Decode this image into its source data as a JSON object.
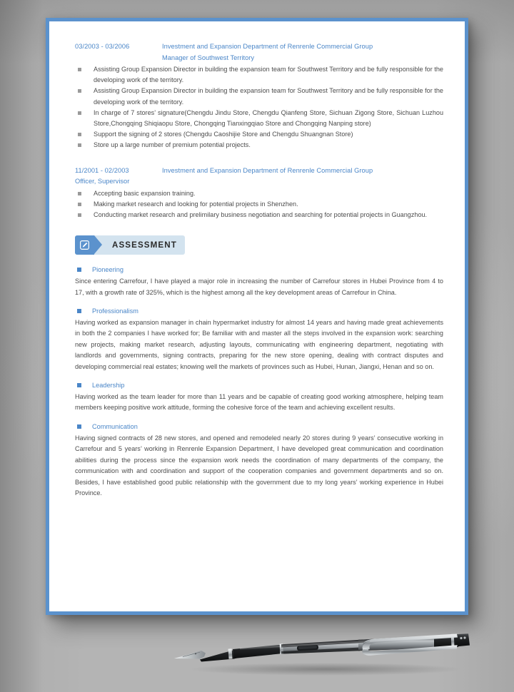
{
  "document": {
    "type": "resume-page",
    "page_border_color": "#5b92cd",
    "accent_color": "#4a86c8",
    "body_text_color": "#4c4c4c",
    "background_color": "#c2c2c2"
  },
  "experience": [
    {
      "dates": "03/2003 - 03/2006",
      "organization": "Investment and Expansion Department of Renrenle Commercial Group",
      "title": "Manager of Southwest Territory",
      "title_indented": true,
      "bullets": [
        "Assisting Group Expansion Director in building the expansion team for Southwest Territory and be fully responsible for the developing work of the territory.",
        "Assisting Group Expansion Director in building the expansion team for Southwest Territory and be fully responsible for the developing work of the territory.",
        "In charge of 7 stores’ signature(Chengdu Jindu Store, Chengdu Qianfeng Store, Sichuan Zigong Store, Sichuan Luzhou Store,Chongqing Shiqiaopu Store, Chongqing Tianxingqiao Store and Chongqing Nanping store)",
        "Support the signing of 2 stores (Chengdu Caoshijie Store and Chengdu Shuangnan Store)",
        "Store up a large number of premium potential projects."
      ]
    },
    {
      "dates": "11/2001 - 02/2003",
      "organization": "Investment and Expansion Department of Renrenle Commercial Group",
      "title": "Officer, Supervisor",
      "title_indented": false,
      "bullets": [
        "Accepting basic expansion training.",
        "Making market research and looking for potential projects in Shenzhen.",
        "Conducting market research and prelimilary business negotiation and searching for potential projects in Guangzhou."
      ]
    }
  ],
  "assessment_section": {
    "heading": "ASSESSMENT",
    "icon": "pencil-edit-icon",
    "items": [
      {
        "title": "Pioneering",
        "body": "Since entering Carrefour, I have played a major role in increasing the number of Carrefour stores in Hubei Province from 4 to 17, with a growth rate of 325%, which is the highest among all the key development areas of Carrefour in China."
      },
      {
        "title": "Professionalism",
        "body": "Having worked as expansion manager in chain hypermarket industry for almost 14 years and having made great achievements in both the 2 companies I have worked for; Be familiar with and master all the steps involved in the expansion work: searching new projects, making market research, adjusting layouts, communicating with engineering department, negotiating with landlords and governments, signing contracts, preparing for the new store opening, dealing with contract disputes and developing commercial real estates; knowing well the markets of provinces such as Hubei, Hunan, Jiangxi, Henan and so on."
      },
      {
        "title": "Leadership",
        "body": "Having worked as the team leader for more than 11 years and be capable of creating good working atmosphere, helping team members keeping positive work attitude, forming the cohesive force of the team and achieving excellent results."
      },
      {
        "title": "Communication",
        "body": "Having signed contracts of 28 new stores, and opened and remodeled nearly 20 stores during 9 years’ consecutive working in Carrefour and 5 years’ working in Renrenle Expansion Department, I have developed great communication and coordination abilities during the process since the expansion work needs the coordination of many departments of the company, the communication with and coordination and support of the cooperation companies and government departments and so on. Besides, I have established good public relationship with the government due to my long years’ working experience in Hubei Province."
      }
    ]
  },
  "decoration": {
    "pen": "fountain-pen-image"
  }
}
